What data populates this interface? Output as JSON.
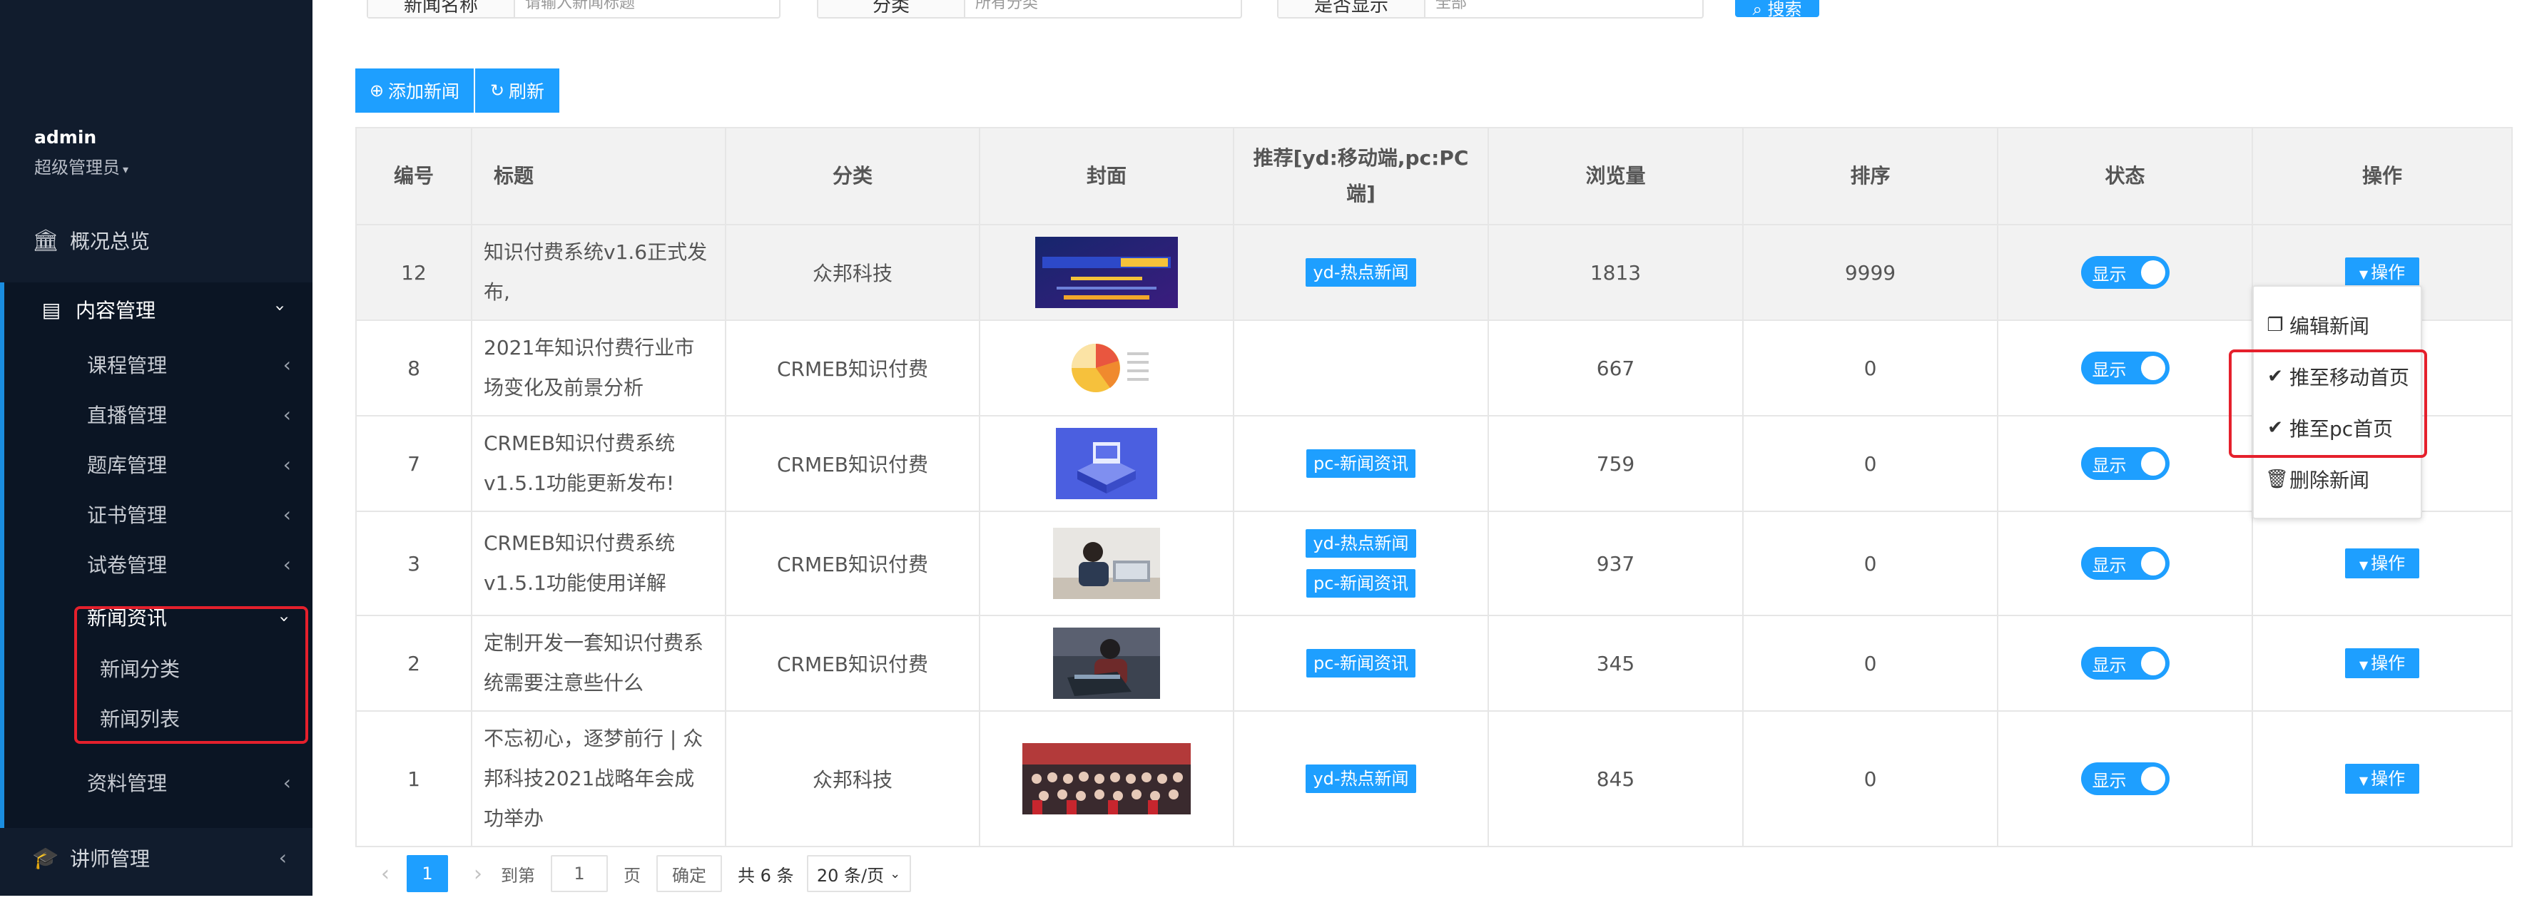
{
  "sidebar": {
    "user_name": "admin",
    "user_role": "超级管理员",
    "overview": "概况总览",
    "content_group": "内容管理",
    "sub_items": [
      "课程管理",
      "直播管理",
      "题库管理",
      "证书管理",
      "试卷管理"
    ],
    "news": "新闻资讯",
    "news_children": [
      "新闻分类",
      "新闻列表"
    ],
    "materials": "资料管理",
    "lecturer": "讲师管理"
  },
  "search": {
    "name_label": "新闻名称",
    "name_placeholder": "请输入新闻标题",
    "category_label": "分类",
    "category_value": "所有分类",
    "display_label": "是否显示",
    "display_value": "全部",
    "button": "搜索"
  },
  "toolbar": {
    "add": "添加新闻",
    "refresh": "刷新"
  },
  "table": {
    "headers": [
      "编号",
      "标题",
      "分类",
      "封面",
      "推荐[yd:移动端,pc:PC端]",
      "浏览量",
      "排序",
      "状态",
      "操作"
    ],
    "rows": [
      {
        "id": "12",
        "title": "知识付费系统v1.6正式发布,",
        "category": "众邦科技",
        "tags": [
          "yd-热点新闻"
        ],
        "views": "1813",
        "sort": "9999",
        "status": "显示",
        "op": "操作"
      },
      {
        "id": "8",
        "title": "2021年知识付费行业市场变化及前景分析",
        "category": "CRMEB知识付费",
        "tags": [],
        "views": "667",
        "sort": "0",
        "status": "显示",
        "op": "操作"
      },
      {
        "id": "7",
        "title": "CRMEB知识付费系统v1.5.1功能更新发布!",
        "category": "CRMEB知识付费",
        "tags": [
          "pc-新闻资讯"
        ],
        "views": "759",
        "sort": "0",
        "status": "显示",
        "op": "操作"
      },
      {
        "id": "3",
        "title": "CRMEB知识付费系统v1.5.1功能使用详解",
        "category": "CRMEB知识付费",
        "tags": [
          "yd-热点新闻",
          "pc-新闻资讯"
        ],
        "views": "937",
        "sort": "0",
        "status": "显示",
        "op": "操作"
      },
      {
        "id": "2",
        "title": "定制开发一套知识付费系统需要注意些什么",
        "category": "CRMEB知识付费",
        "tags": [
          "pc-新闻资讯"
        ],
        "views": "345",
        "sort": "0",
        "status": "显示",
        "op": "操作"
      },
      {
        "id": "1",
        "title": "不忘初心，逐梦前行 | 众邦科技2021战略年会成功举办",
        "category": "众邦科技",
        "tags": [
          "yd-热点新闻"
        ],
        "views": "845",
        "sort": "0",
        "status": "显示",
        "op": "操作"
      }
    ]
  },
  "dropdown": {
    "edit": "编辑新闻",
    "push_mobile": "推至移动首页",
    "push_pc": "推至pc首页",
    "delete": "删除新闻"
  },
  "pager": {
    "current": "1",
    "goto": "到第",
    "page_input": "1",
    "page_unit": "页",
    "confirm": "确定",
    "total": "共 6 条",
    "per_page": "20 条/页"
  },
  "colors": {
    "sidebar": "#111c2d",
    "primary": "#1e9fff",
    "highlight": "#e5202c"
  }
}
